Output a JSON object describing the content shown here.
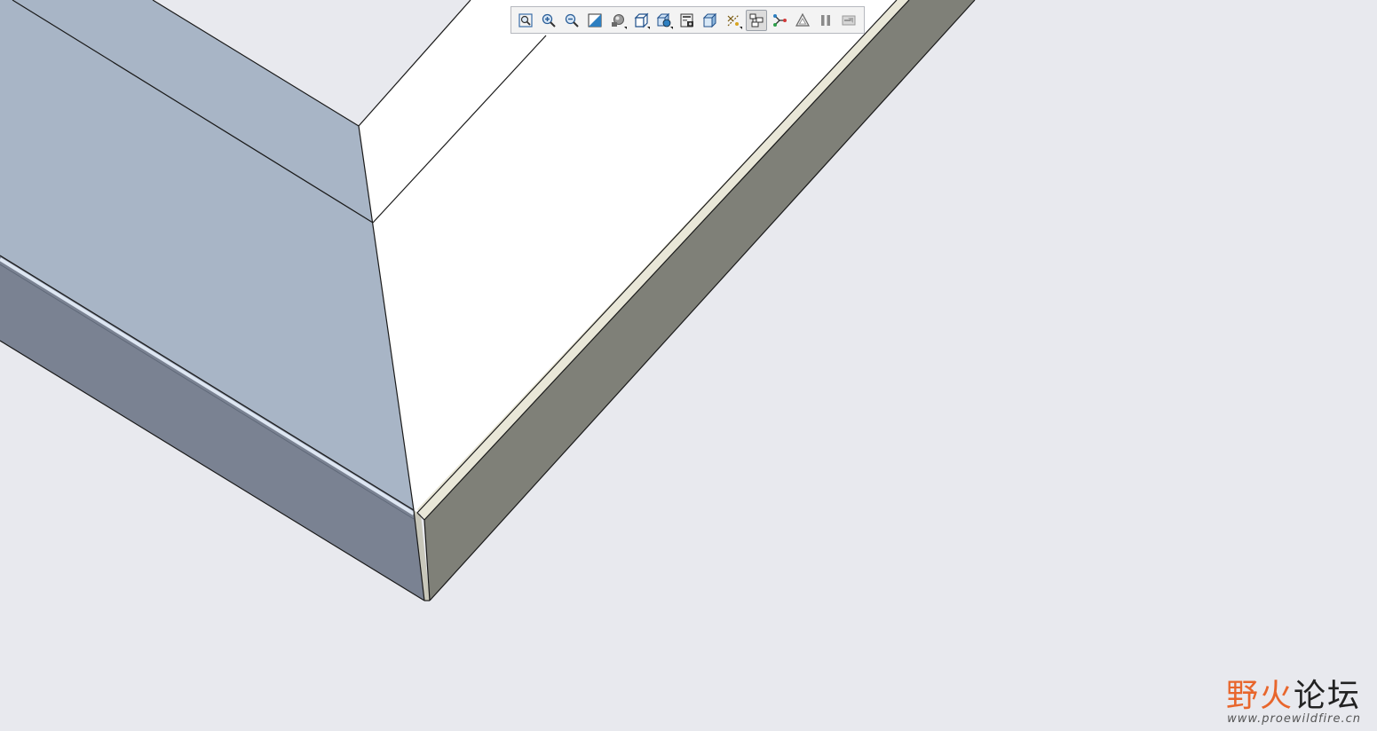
{
  "viewport": {
    "background": "#e8e9ee",
    "colors": {
      "blue_face": "#a8b5c6",
      "blue_side": "#7a8292",
      "white_face": "#ffffff",
      "gray_side": "#7f8078",
      "edge_line": "#1a1a1a"
    }
  },
  "toolbar": {
    "items": [
      {
        "name": "refit-icon",
        "active": false,
        "dropdown": false
      },
      {
        "name": "zoom-in-icon",
        "active": false,
        "dropdown": false
      },
      {
        "name": "zoom-out-icon",
        "active": false,
        "dropdown": false
      },
      {
        "name": "repaint-icon",
        "active": false,
        "dropdown": false
      },
      {
        "name": "display-style-icon",
        "active": false,
        "dropdown": true
      },
      {
        "name": "saved-orientations-icon",
        "active": false,
        "dropdown": true
      },
      {
        "name": "view-manager-icon",
        "active": false,
        "dropdown": true
      },
      {
        "name": "perspective-view-icon",
        "active": false,
        "dropdown": false
      },
      {
        "name": "section-view-icon",
        "active": false,
        "dropdown": false
      },
      {
        "name": "datum-display-icon",
        "active": false,
        "dropdown": true
      },
      {
        "name": "annotation-display-icon",
        "active": true,
        "dropdown": false
      },
      {
        "name": "spin-center-icon",
        "active": false,
        "dropdown": false
      },
      {
        "name": "appearance-icon",
        "active": false,
        "dropdown": false
      },
      {
        "name": "pause-icon",
        "active": false,
        "dropdown": false
      },
      {
        "name": "regenerate-icon",
        "active": false,
        "dropdown": false
      }
    ]
  },
  "watermark": {
    "title_part1": "野火",
    "title_part2": "论坛",
    "url": "www.proewildfire.cn",
    "accent_color": "#e8662c"
  }
}
